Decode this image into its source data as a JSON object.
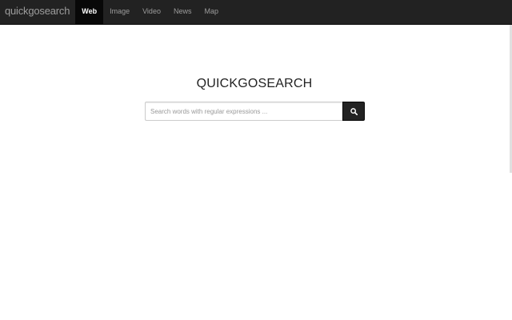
{
  "navbar": {
    "brand": "quickgosearch",
    "items": [
      {
        "label": "Web",
        "active": true
      },
      {
        "label": "Image",
        "active": false
      },
      {
        "label": "Video",
        "active": false
      },
      {
        "label": "News",
        "active": false
      },
      {
        "label": "Map",
        "active": false
      }
    ]
  },
  "main": {
    "title": "QUICKGOSEARCH",
    "search": {
      "value": "",
      "placeholder": "Search words with regular expressions ..."
    },
    "search_button_icon": "search-icon"
  },
  "colors": {
    "navbar_bg": "#222222",
    "active_tab_bg": "#080808",
    "nav_text": "#9d9d9d",
    "button_bg": "#222222"
  }
}
